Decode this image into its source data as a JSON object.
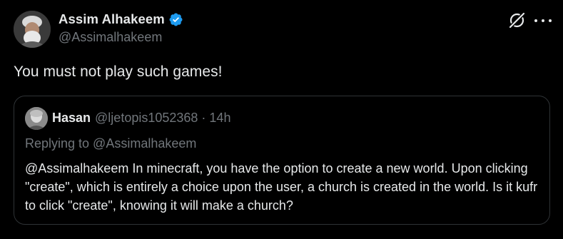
{
  "author": {
    "name": "Assim Alhakeem",
    "handle": "@Assimalhakeem",
    "verified": true
  },
  "icons": {
    "verified": "verified-badge-icon",
    "grok": "grok-icon",
    "more": "more-icon"
  },
  "colors": {
    "background": "#000000",
    "primary_text": "#e7e9ea",
    "secondary_text": "#71767b",
    "border": "#2f3336",
    "verified_blue": "#1d9bf0"
  },
  "tweet": {
    "text": "You must not play such games!"
  },
  "quoted": {
    "name": "Hasan",
    "handle": "@ljetopis1052368",
    "separator": "·",
    "time": "14h",
    "replying_to": "Replying to @Assimalhakeem",
    "text": "@Assimalhakeem In minecraft, you have the option to create a new world. Upon clicking \"create\", which is entirely a choice upon the user, a church is created in the world. Is it kufr to click \"create\", knowing it will make a church?"
  }
}
